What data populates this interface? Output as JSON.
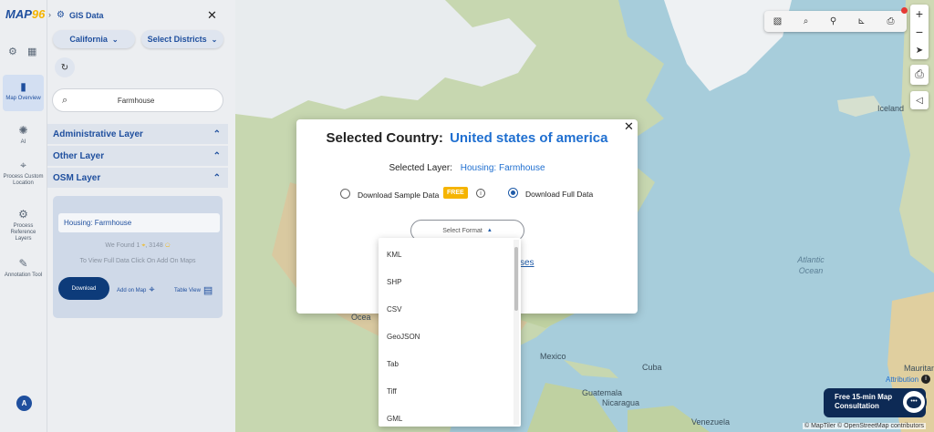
{
  "app": {
    "logo": "MAP",
    "logo_suffix": "96",
    "panel_title": "GIS Data",
    "close_glyph": "✕"
  },
  "rail": {
    "items": [
      {
        "label": "Map Overview",
        "icon": "map-icon"
      },
      {
        "label": "AI",
        "icon": "ai-icon"
      },
      {
        "label": "Process Custom Location",
        "icon": "location-pin-icon"
      },
      {
        "label": "Process Reference Layers",
        "icon": "layers-gear-icon"
      },
      {
        "label": "Annotation Tool",
        "icon": "annotation-icon"
      }
    ],
    "avatar_initial": "A"
  },
  "filters": {
    "country": "California",
    "districts": "Select Districts"
  },
  "search": {
    "value": "Farmhouse"
  },
  "sections": [
    {
      "label": "Administrative Layer"
    },
    {
      "label": "Other Layer"
    },
    {
      "label": "OSM Layer"
    }
  ],
  "result_card": {
    "layer_name": "Housing: Farmhouse",
    "found_prefix": "We Found",
    "found_count_a": "1",
    "found_count_b": "3148",
    "instruction": "To View Full Data Click On Add On Maps",
    "download_label": "Download",
    "add_on_map_label": "Add on Map",
    "table_view_label": "Table View"
  },
  "modal": {
    "country_label": "Selected Country:",
    "country_value": "United states of america",
    "layer_label": "Selected Layer:",
    "layer_value": "Housing: Farmhouse",
    "sample_label": "Download Sample Data",
    "free_badge": "FREE",
    "full_label": "Download Full Data",
    "format_placeholder": "Select Format",
    "link_fragment": "ses"
  },
  "format_options": [
    "KML",
    "SHP",
    "CSV",
    "GeoJSON",
    "Tab",
    "Tiff",
    "GML"
  ],
  "map": {
    "labels": [
      "Iceland",
      "Atlantic Ocean",
      "Mexico",
      "Cuba",
      "Guatemala",
      "Nicaragua",
      "Venezuela",
      "Mauritani",
      "Ocea"
    ],
    "attribution_link": "Attribution",
    "copyright": "© MapTiler © OpenStreetMap contributors"
  },
  "consult": {
    "line1": "Free 15-min Map",
    "line2": "Consultation"
  },
  "colors": {
    "brand_blue": "#1f4f9e",
    "accent_blue": "#1f6fd0",
    "free_badge": "#f5b400",
    "consult_bg": "#0d2a55"
  }
}
